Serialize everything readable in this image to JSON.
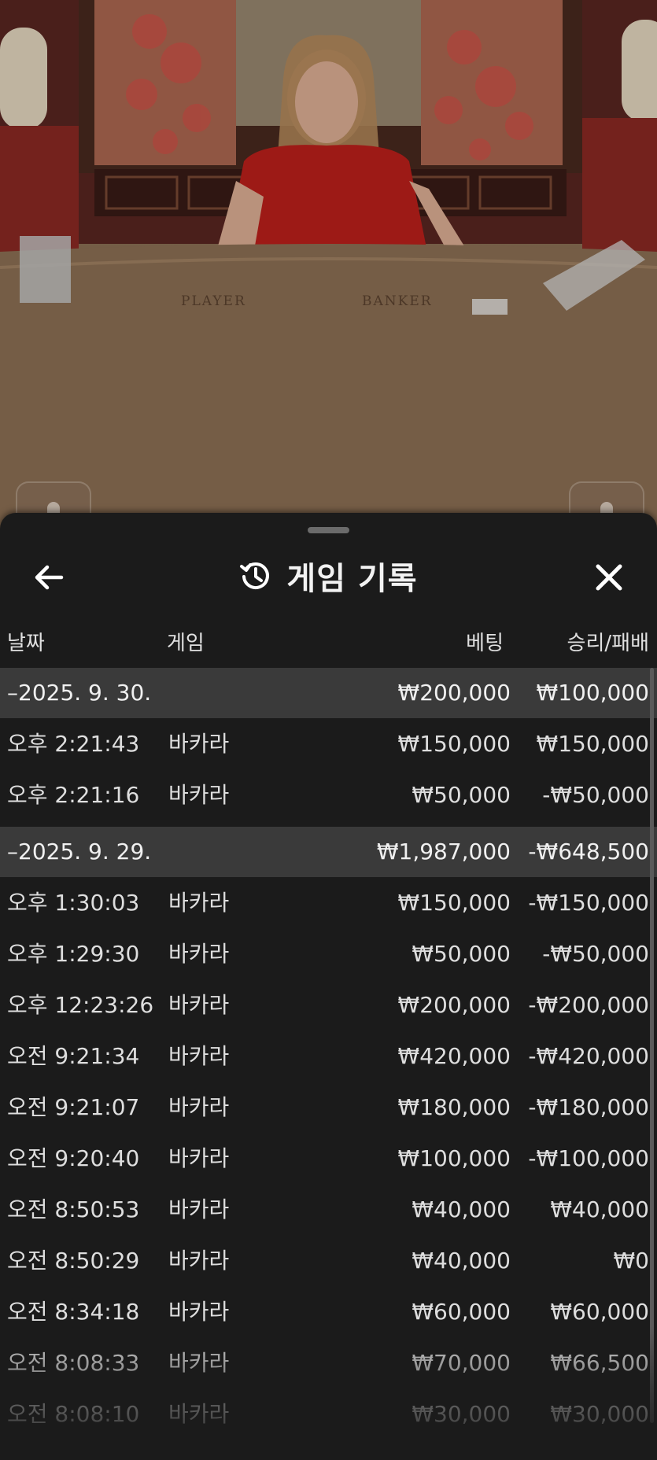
{
  "video": {
    "table_labels": [
      "PLAYER",
      "BANKER"
    ]
  },
  "sheet": {
    "title": "게임 기록",
    "icons": {
      "back": "arrow-left-icon",
      "history": "history-icon",
      "close": "close-icon"
    },
    "columns": {
      "date": "날짜",
      "game": "게임",
      "bet": "베팅",
      "win_loss": "승리/패배"
    },
    "groups": [
      {
        "date": "–2025. 9. 30.",
        "bet": "₩200,000",
        "win_loss": "₩100,000",
        "rows": [
          {
            "time": "오후 2:21:43",
            "game": "바카라",
            "bet": "₩150,000",
            "win_loss": "₩150,000"
          },
          {
            "time": "오후 2:21:16",
            "game": "바카라",
            "bet": "₩50,000",
            "win_loss": "-₩50,000"
          }
        ]
      },
      {
        "date": "–2025. 9. 29.",
        "bet": "₩1,987,000",
        "win_loss": "-₩648,500",
        "rows": [
          {
            "time": "오후 1:30:03",
            "game": "바카라",
            "bet": "₩150,000",
            "win_loss": "-₩150,000"
          },
          {
            "time": "오후 1:29:30",
            "game": "바카라",
            "bet": "₩50,000",
            "win_loss": "-₩50,000"
          },
          {
            "time": "오후 12:23:26",
            "game": "바카라",
            "bet": "₩200,000",
            "win_loss": "-₩200,000"
          },
          {
            "time": "오전 9:21:34",
            "game": "바카라",
            "bet": "₩420,000",
            "win_loss": "-₩420,000"
          },
          {
            "time": "오전 9:21:07",
            "game": "바카라",
            "bet": "₩180,000",
            "win_loss": "-₩180,000"
          },
          {
            "time": "오전 9:20:40",
            "game": "바카라",
            "bet": "₩100,000",
            "win_loss": "-₩100,000"
          },
          {
            "time": "오전 8:50:53",
            "game": "바카라",
            "bet": "₩40,000",
            "win_loss": "₩40,000"
          },
          {
            "time": "오전 8:50:29",
            "game": "바카라",
            "bet": "₩40,000",
            "win_loss": "₩0"
          },
          {
            "time": "오전 8:34:18",
            "game": "바카라",
            "bet": "₩60,000",
            "win_loss": "₩60,000"
          },
          {
            "time": "오전 8:08:33",
            "game": "바카라",
            "bet": "₩70,000",
            "win_loss": "₩66,500"
          },
          {
            "time": "오전 8:08:10",
            "game": "바카라",
            "bet": "₩30,000",
            "win_loss": "₩30,000"
          }
        ]
      }
    ]
  }
}
